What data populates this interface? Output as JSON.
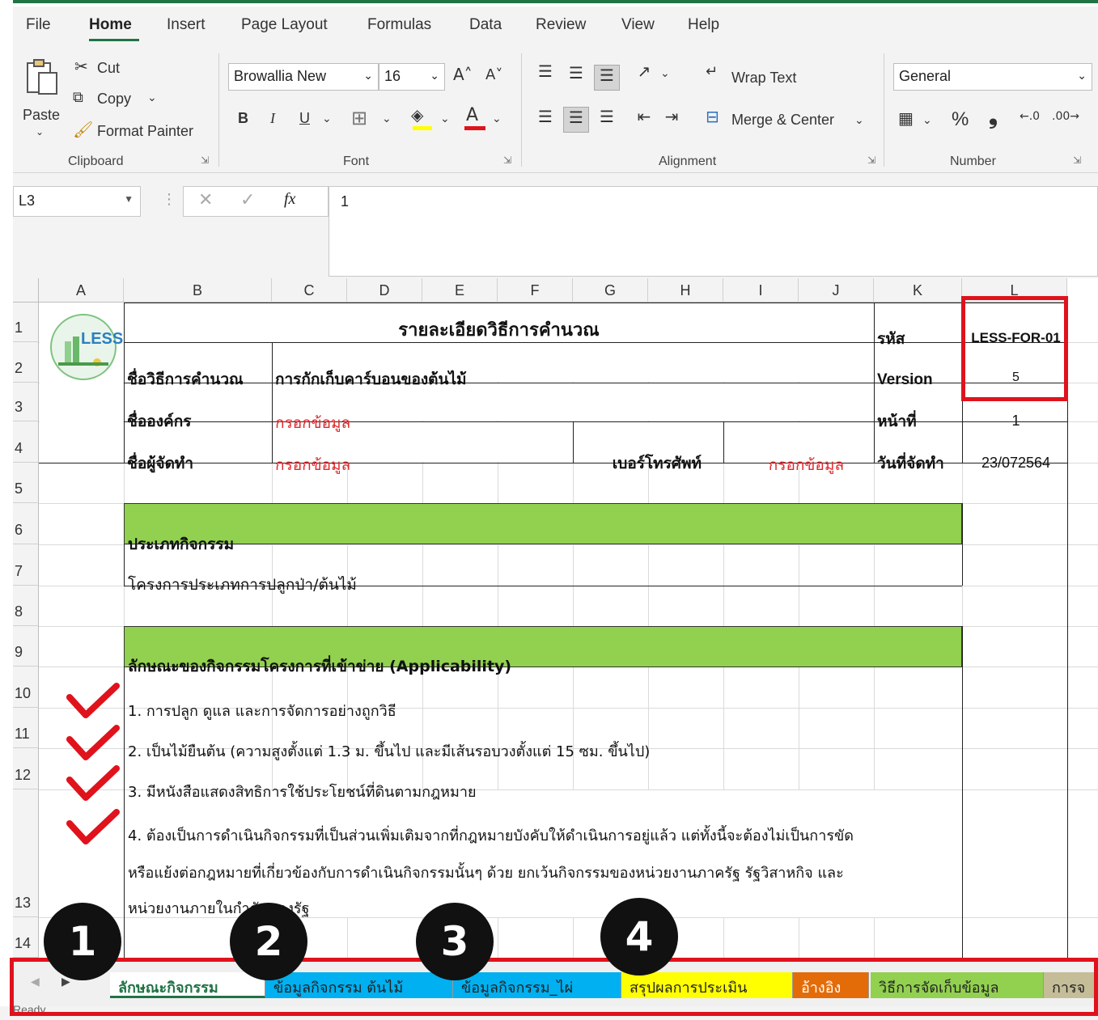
{
  "ribbon": {
    "tabs": [
      "File",
      "Home",
      "Insert",
      "Page Layout",
      "Formulas",
      "Data",
      "Review",
      "View",
      "Help"
    ],
    "active_tab": "Home",
    "clipboard": {
      "paste": "Paste",
      "cut": "Cut",
      "copy": "Copy",
      "format_painter": "Format Painter",
      "label": "Clipboard"
    },
    "font": {
      "name": "Browallia New",
      "size": "16",
      "bold": "B",
      "italic": "I",
      "underline": "U",
      "label": "Font"
    },
    "alignment": {
      "wrap_text": "Wrap Text",
      "merge_center": "Merge & Center",
      "label": "Alignment"
    },
    "number": {
      "format": "General",
      "percent": "%",
      "comma": "❟",
      "label": "Number"
    }
  },
  "formula_bar": {
    "name_box": "L3",
    "value": "1",
    "fx": "fx"
  },
  "columns": [
    "A",
    "B",
    "C",
    "D",
    "E",
    "F",
    "G",
    "H",
    "I",
    "J",
    "K",
    "L"
  ],
  "rows": [
    "1",
    "2",
    "3",
    "4",
    "5",
    "6",
    "7",
    "8",
    "9",
    "10",
    "11",
    "12",
    "13",
    "14"
  ],
  "sheet": {
    "title": "รายละเอียดวิธีการคำนวณ",
    "code_label": "รหัส",
    "code_value": "LESS-FOR-01",
    "version_label": "Version",
    "version_value": "5",
    "page_label": "หน้าที่",
    "page_value": "1",
    "date_label": "วันที่จัดทำ",
    "date_value": "23/072564",
    "method_label": "ชื่อวิธีการคำนวณ",
    "method_value": "การกักเก็บคาร์บอนของต้นไม้",
    "org_label": "ชื่อองค์กร",
    "org_value": "กรอกข้อมูล",
    "author_label": "ชื่อผู้จัดทำ",
    "author_value": "กรอกข้อมูล",
    "phone_label": "เบอร์โทรศัพท์",
    "phone_value": "กรอกข้อมูล",
    "activity_type_header": "ประเภทกิจกรรม",
    "activity_type_value": "โครงการประเภทการปลูกป่า/ต้นไม้",
    "applicability_header": "ลักษณะของกิจกรรมโครงการที่เข้าข่าย (Applicability)",
    "items": [
      "1. การปลูก ดูแล และการจัดการอย่างถูกวิธี",
      "2. เป็นไม้ยืนต้น (ความสูงตั้งแต่ 1.3 ม. ขึ้นไป และมีเส้นรอบวงตั้งแต่ 15 ซม. ขึ้นไป)",
      "3. มีหนังสือแสดงสิทธิการใช้ประโยชน์ที่ดินตามกฎหมาย",
      "4. ต้องเป็นการดำเนินกิจกรรมที่เป็นส่วนเพิ่มเติมจากที่กฎหมายบังคับให้ดำเนินการอยู่แล้ว แต่ทั้งนี้จะต้องไม่เป็นการขัด",
      "หรือแย้งต่อกฎหมายที่เกี่ยวข้องกับการดำเนินกิจกรรมนั้นๆ ด้วย ยกเว้นกิจกรรมของหน่วยงานภาครัฐ รัฐวิสาหกิจ และ",
      "หน่วยงานภายในกำกับของรัฐ"
    ],
    "logo_text": "LESS"
  },
  "sheet_tabs": [
    {
      "label": "ลักษณะกิจกรรม",
      "color": "#ffffff"
    },
    {
      "label": "ข้อมูลกิจกรรม ต้นไม้",
      "color": "#00b0f0"
    },
    {
      "label": "ข้อมูลกิจกรรม_ไผ่",
      "color": "#00b0f0"
    },
    {
      "label": "สรุปผลการประเมิน",
      "color": "#ffff00"
    },
    {
      "label": "อ้างอิง",
      "color": "#e36c09"
    },
    {
      "label": "วิธีการจัดเก็บข้อมูล",
      "color": "#92d050"
    },
    {
      "label": "การจ",
      "color": "#c4bd97"
    }
  ],
  "callouts": [
    "1",
    "2",
    "3",
    "4"
  ],
  "status": {
    "ready": "Ready"
  },
  "colors": {
    "excel_green": "#217346",
    "highlight_red": "#e0121c",
    "section_green": "#92d050",
    "input_red": "#e0262b"
  }
}
